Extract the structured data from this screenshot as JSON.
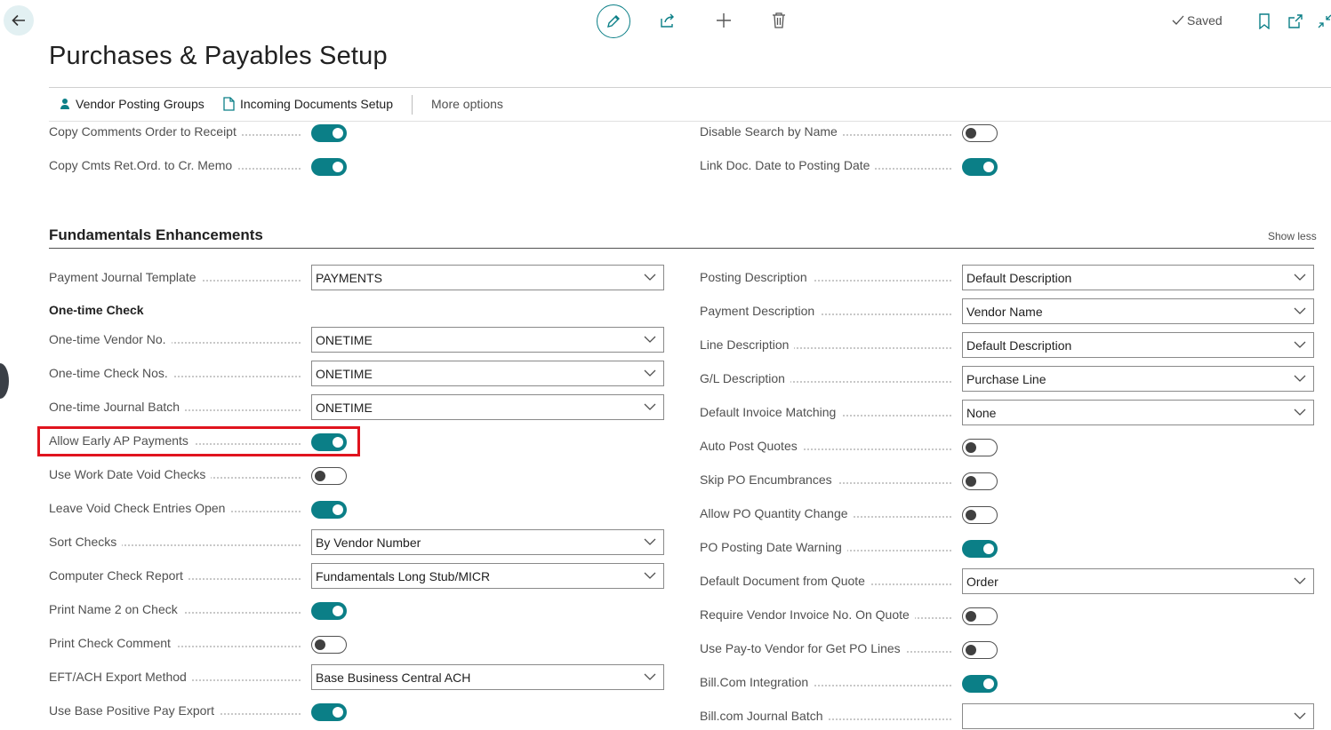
{
  "page": {
    "title": "Purchases & Payables Setup",
    "saved_label": "Saved"
  },
  "actions": {
    "vendor_posting_groups": "Vendor Posting Groups",
    "incoming_documents_setup": "Incoming Documents Setup",
    "more_options": "More options"
  },
  "top_fields": [
    {
      "label": "Copy Comments Order to Receipt",
      "type": "toggle",
      "on": true
    },
    {
      "label": "Copy Cmts Ret.Ord. to Cr. Memo",
      "type": "toggle",
      "on": true
    },
    {
      "label": "Disable Search by Name",
      "type": "toggle",
      "on": false
    },
    {
      "label": "Link Doc. Date to Posting Date",
      "type": "toggle",
      "on": true
    }
  ],
  "section": {
    "title": "Fundamentals Enhancements",
    "show_less": "Show less",
    "subheading": "One-time Check"
  },
  "left_fields": [
    {
      "label": "Payment Journal Template",
      "type": "select",
      "value": "PAYMENTS"
    },
    {
      "label": "One-time Vendor No.",
      "type": "select",
      "value": "ONETIME"
    },
    {
      "label": "One-time Check Nos.",
      "type": "select",
      "value": "ONETIME"
    },
    {
      "label": "One-time Journal Batch",
      "type": "select",
      "value": "ONETIME"
    },
    {
      "label": "Allow Early AP Payments",
      "type": "toggle",
      "on": true,
      "highlighted": true
    },
    {
      "label": "Use Work Date Void Checks",
      "type": "toggle",
      "on": false
    },
    {
      "label": "Leave Void Check Entries Open",
      "type": "toggle",
      "on": true
    },
    {
      "label": "Sort Checks",
      "type": "select",
      "value": "By Vendor Number"
    },
    {
      "label": "Computer Check Report",
      "type": "select",
      "value": "Fundamentals Long Stub/MICR"
    },
    {
      "label": "Print Name 2 on Check",
      "type": "toggle",
      "on": true
    },
    {
      "label": "Print Check Comment",
      "type": "toggle",
      "on": false
    },
    {
      "label": "EFT/ACH Export Method",
      "type": "select",
      "value": "Base Business Central ACH"
    },
    {
      "label": "Use Base Positive Pay Export",
      "type": "toggle",
      "on": true
    }
  ],
  "right_fields": [
    {
      "label": "Posting Description",
      "type": "select",
      "value": "Default Description"
    },
    {
      "label": "Payment Description",
      "type": "select",
      "value": "Vendor Name"
    },
    {
      "label": "Line Description",
      "type": "select",
      "value": "Default Description"
    },
    {
      "label": "G/L Description",
      "type": "select",
      "value": "Purchase Line"
    },
    {
      "label": "Default Invoice Matching",
      "type": "select",
      "value": "None"
    },
    {
      "label": "Auto Post Quotes",
      "type": "toggle",
      "on": false
    },
    {
      "label": "Skip PO Encumbrances",
      "type": "toggle",
      "on": false
    },
    {
      "label": "Allow PO Quantity Change",
      "type": "toggle",
      "on": false
    },
    {
      "label": "PO Posting Date Warning",
      "type": "toggle",
      "on": true
    },
    {
      "label": "Default Document from Quote",
      "type": "select",
      "value": "Order"
    },
    {
      "label": "Require Vendor Invoice No. On Quote",
      "type": "toggle",
      "on": false
    },
    {
      "label": "Use Pay-to Vendor for Get PO Lines",
      "type": "toggle",
      "on": false
    },
    {
      "label": "Bill.Com Integration",
      "type": "toggle",
      "on": true
    },
    {
      "label": "Bill.com Journal Batch",
      "type": "select",
      "value": ""
    }
  ],
  "colors": {
    "accent": "#0b7f87",
    "highlight": "#e0141e"
  }
}
